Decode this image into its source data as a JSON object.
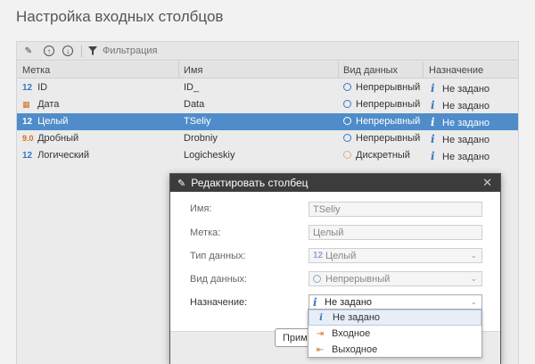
{
  "page": {
    "title": "Настройка входных столбцов"
  },
  "toolbar": {
    "filter_placeholder": "Фильтрация"
  },
  "grid": {
    "headers": [
      "Метка",
      "Имя",
      "Вид данных",
      "Назначение"
    ],
    "rows": [
      {
        "type_icon": "12",
        "label": "ID",
        "name": "ID_",
        "kind": "Непрерывный",
        "purpose": "Не задано"
      },
      {
        "type_icon": "calendar",
        "label": "Дата",
        "name": "Data",
        "kind": "Непрерывный",
        "purpose": "Не задано"
      },
      {
        "type_icon": "12",
        "label": "Целый",
        "name": "TSeliy",
        "kind": "Непрерывный",
        "purpose": "Не задано",
        "selected": true
      },
      {
        "type_icon": "9.0",
        "label": "Дробный",
        "name": "Drobniy",
        "kind": "Непрерывный",
        "purpose": "Не задано"
      },
      {
        "type_icon": "12",
        "label": "Логический",
        "name": "Logicheskiy",
        "kind": "Дискретный",
        "purpose": "Не задано"
      }
    ]
  },
  "modal": {
    "title": "Редактировать столбец",
    "fields": {
      "name_label": "Имя:",
      "name_value": "TSeliy",
      "label_label": "Метка:",
      "label_value": "Целый",
      "dtype_label": "Тип данных:",
      "dtype_icon": "12",
      "dtype_value": "Целый",
      "kind_label": "Вид данных:",
      "kind_value": "Непрерывный",
      "purpose_label": "Назначение:",
      "purpose_value": "Не задано"
    },
    "apply_button": "Приме"
  },
  "dropdown": {
    "options": [
      "Не задано",
      "Входное",
      "Выходное"
    ]
  },
  "colors": {
    "selection": "#4f8cc9",
    "modal_header": "#3c3c3c",
    "accent_orange": "#d07020",
    "accent_blue": "#3a78c2"
  }
}
